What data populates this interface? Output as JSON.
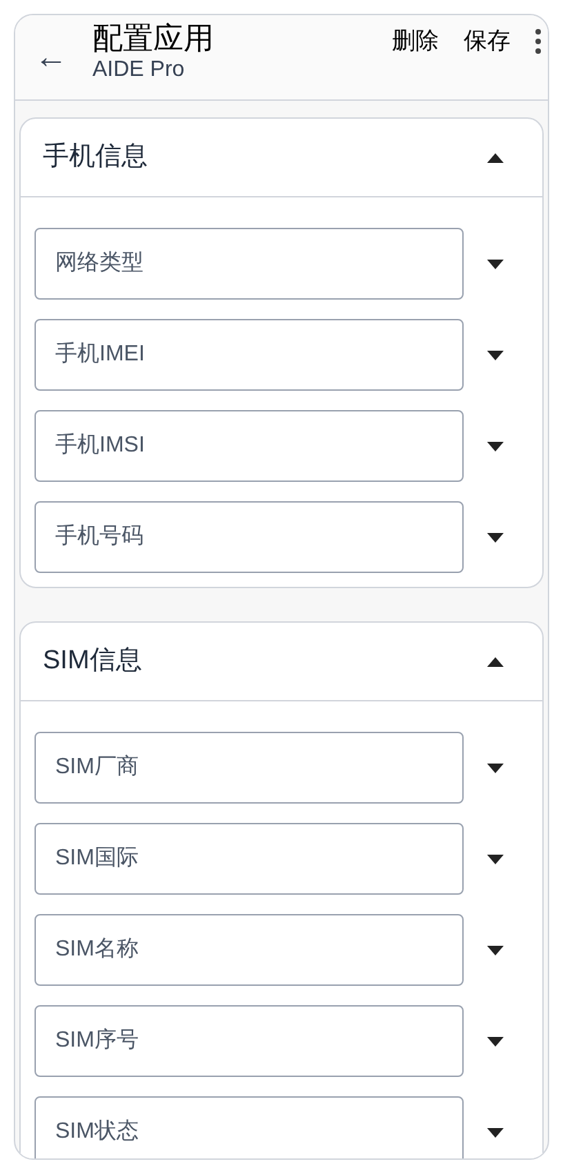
{
  "app_bar": {
    "back": "←",
    "title": "配置应用",
    "subtitle": "AIDE Pro",
    "actions": [
      "删除",
      "保存"
    ]
  },
  "sections": [
    {
      "title": "手机信息",
      "expanded": true,
      "fields": [
        {
          "placeholder": "网络类型"
        },
        {
          "placeholder": "手机IMEI"
        },
        {
          "placeholder": "手机IMSI"
        },
        {
          "placeholder": "手机号码"
        }
      ]
    },
    {
      "title": "SIM信息",
      "expanded": true,
      "fields": [
        {
          "placeholder": "SIM厂商"
        },
        {
          "placeholder": "SIM国际"
        },
        {
          "placeholder": "SIM名称"
        },
        {
          "placeholder": "SIM序号"
        },
        {
          "placeholder": "SIM状态"
        }
      ]
    }
  ]
}
